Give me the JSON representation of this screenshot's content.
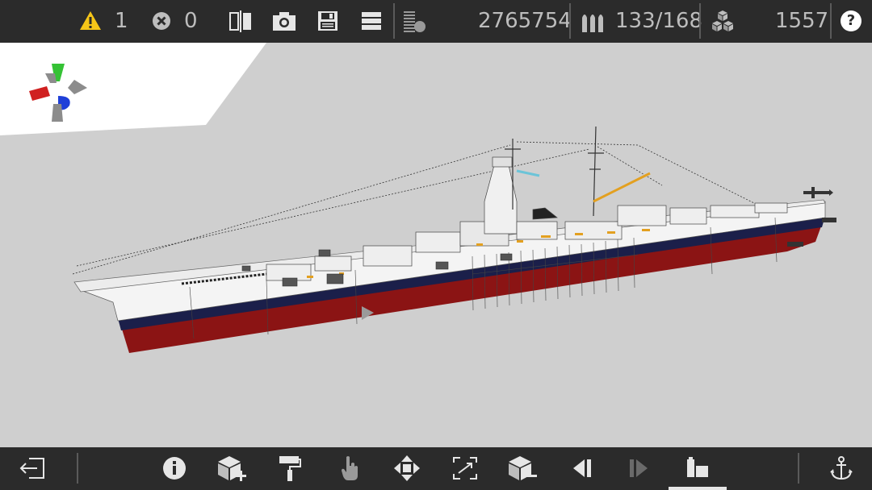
{
  "topbar": {
    "warning_count": "1",
    "error_count": "0",
    "block_count": "2765754",
    "ammo_count": "133/168",
    "parts_count": "1557",
    "help_label": "?"
  },
  "toolbar_icons": [
    "warning-icon",
    "error-icon",
    "mirror-icon",
    "camera-icon",
    "save-icon",
    "layers-icon",
    "stats-icon",
    "ammo-icon",
    "cubes-icon",
    "help-icon"
  ],
  "bottombar_icons": [
    "exit-icon",
    "info-icon",
    "add-block-icon",
    "paint-roller-icon",
    "hand-pointer-icon",
    "move-icon",
    "resize-icon",
    "remove-block-icon",
    "step-back-icon",
    "step-forward-icon",
    "build-mode-icon",
    "anchor-icon"
  ],
  "colors": {
    "bar": "#2b2b2b",
    "icon": "#e6e6e6",
    "warning": "#f5c518",
    "viewport": "#cfcfcf",
    "hull_red": "#8b1414",
    "hull_navy": "#1b1f4a",
    "hull_white": "#f4f4f4",
    "gizmo_green": "#35c235",
    "gizmo_red": "#d02020",
    "gizmo_blue": "#1f3fd8"
  }
}
